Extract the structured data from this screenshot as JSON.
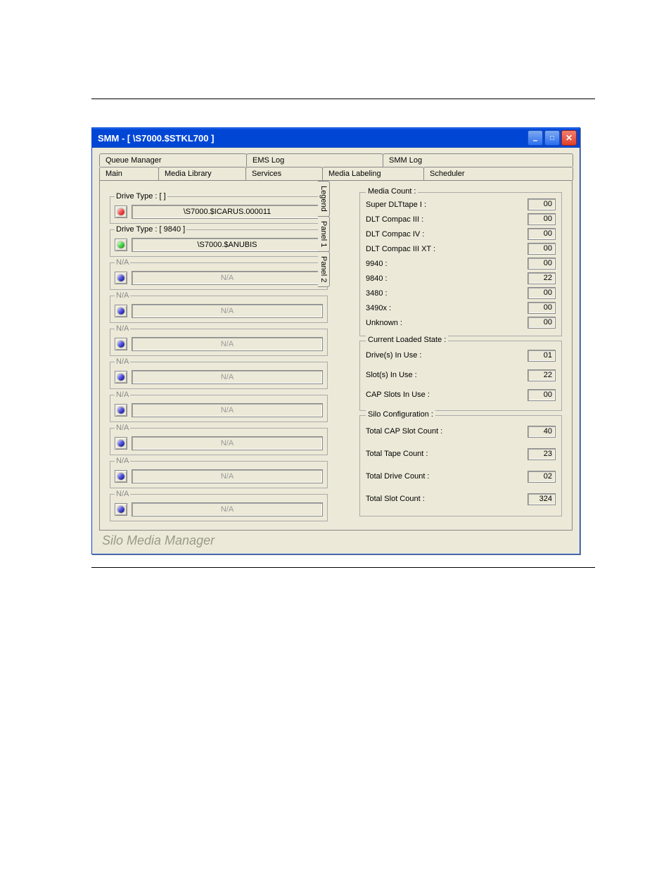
{
  "window": {
    "title": "SMM - [ \\S7000.$STKL700 ]"
  },
  "tabs_row1": [
    "Queue Manager",
    "EMS Log",
    "SMM Log"
  ],
  "tabs_row2": [
    "Main",
    "Media Library",
    "Services",
    "Media Labeling",
    "Scheduler"
  ],
  "side_tabs": [
    "Legend",
    "Panel 1",
    "Panel 2"
  ],
  "drives": [
    {
      "group": "Drive Type : [  ]",
      "led": "red",
      "value": "\\S7000.$ICARUS.000011",
      "enabled": true
    },
    {
      "group": "Drive Type : [ 9840 ]",
      "led": "green",
      "value": "\\S7000.$ANUBIS",
      "enabled": true
    },
    {
      "group": "N/A",
      "led": "blue",
      "value": "N/A",
      "enabled": false
    },
    {
      "group": "N/A",
      "led": "blue",
      "value": "N/A",
      "enabled": false
    },
    {
      "group": "N/A",
      "led": "blue",
      "value": "N/A",
      "enabled": false
    },
    {
      "group": "N/A",
      "led": "blue",
      "value": "N/A",
      "enabled": false
    },
    {
      "group": "N/A",
      "led": "blue",
      "value": "N/A",
      "enabled": false
    },
    {
      "group": "N/A",
      "led": "blue",
      "value": "N/A",
      "enabled": false
    },
    {
      "group": "N/A",
      "led": "blue",
      "value": "N/A",
      "enabled": false
    },
    {
      "group": "N/A",
      "led": "blue",
      "value": "N/A",
      "enabled": false
    }
  ],
  "media_count": {
    "title": "Media Count :",
    "rows": [
      {
        "lbl": "Super DLTtape I :",
        "val": "00"
      },
      {
        "lbl": "DLT Compac III :",
        "val": "00"
      },
      {
        "lbl": "DLT Compac IV :",
        "val": "00"
      },
      {
        "lbl": "DLT Compac III XT :",
        "val": "00"
      },
      {
        "lbl": "9940 :",
        "val": "00"
      },
      {
        "lbl": "9840 :",
        "val": "22"
      },
      {
        "lbl": "3480 :",
        "val": "00"
      },
      {
        "lbl": "3490x :",
        "val": "00"
      },
      {
        "lbl": "Unknown :",
        "val": "00"
      }
    ]
  },
  "loaded_state": {
    "title": "Current Loaded State :",
    "rows": [
      {
        "lbl": "Drive(s) In Use :",
        "val": "01"
      },
      {
        "lbl": "Slot(s) In Use :",
        "val": "22"
      },
      {
        "lbl": "CAP Slots In Use :",
        "val": "00"
      }
    ]
  },
  "silo_config": {
    "title": "Silo Configuration :",
    "rows": [
      {
        "lbl": "Total CAP Slot Count :",
        "val": "40"
      },
      {
        "lbl": "Total Tape Count :",
        "val": "23"
      },
      {
        "lbl": "Total Drive Count :",
        "val": "02"
      },
      {
        "lbl": "Total Slot Count :",
        "val": "324"
      }
    ]
  },
  "footer": "Silo Media Manager"
}
